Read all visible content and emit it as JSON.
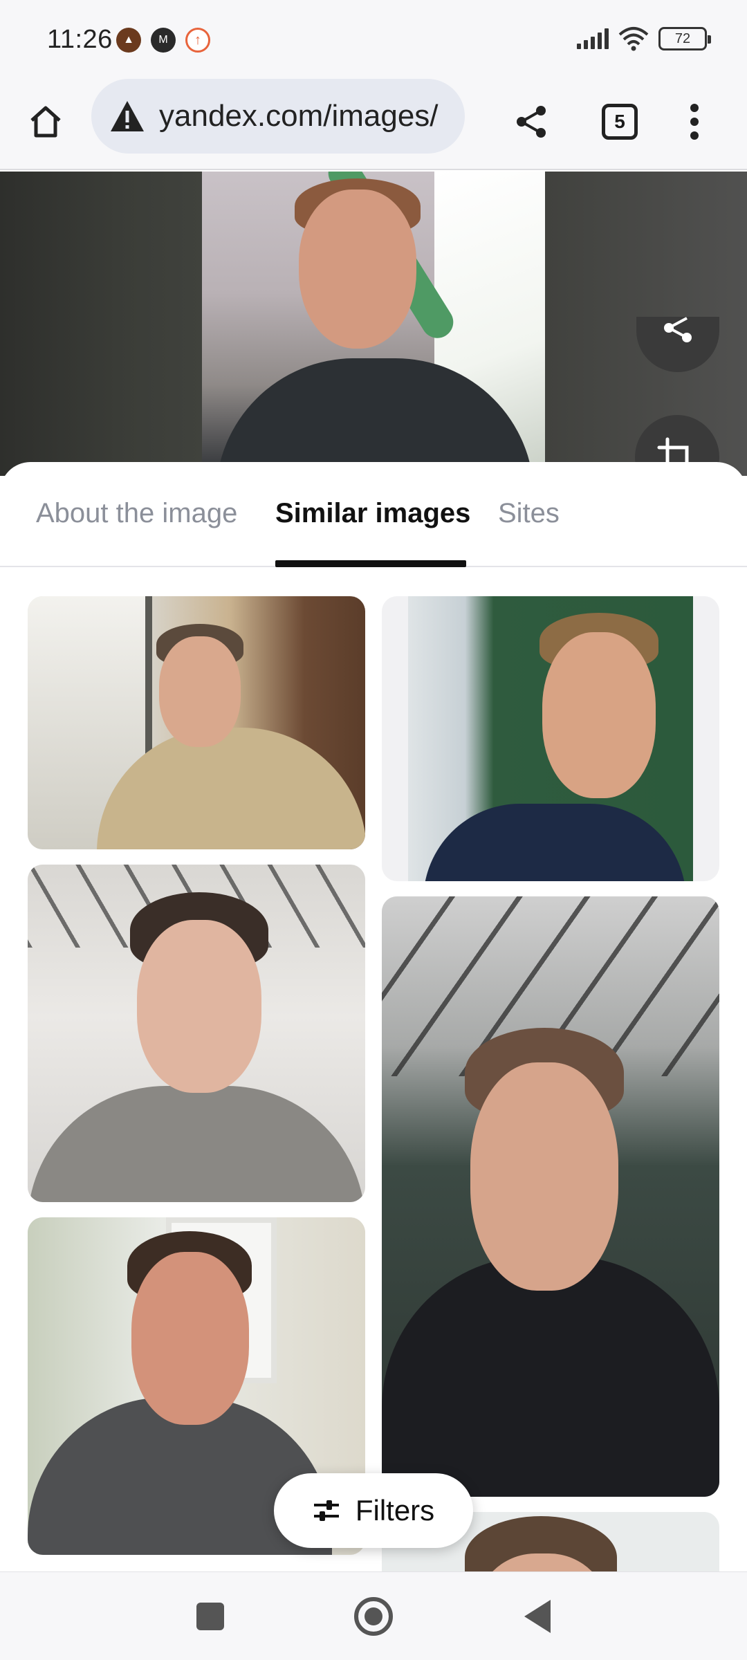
{
  "status_bar": {
    "time": "11:26",
    "battery": "72",
    "left_icons": [
      "shield-icon",
      "mi-icon",
      "upload-arrow-icon"
    ],
    "right_icons": [
      "signal-icon",
      "wifi-icon",
      "battery-icon"
    ]
  },
  "browser": {
    "url": "yandex.com/images/",
    "tab_count": "5",
    "icons": [
      "home-icon",
      "warning-icon",
      "share-icon",
      "tabs-icon",
      "more-vertical-icon"
    ]
  },
  "preview": {
    "actions": [
      "share-icon",
      "crop-icon"
    ]
  },
  "tabs": [
    {
      "label": "About the image",
      "active": false
    },
    {
      "label": "Similar images",
      "active": true
    },
    {
      "label": "Sites",
      "active": false
    }
  ],
  "results": {
    "tile_count": 7
  },
  "filters": {
    "label": "Filters",
    "icon": "sliders-icon"
  },
  "nav": {
    "icons": [
      "recents-square-icon",
      "home-circle-icon",
      "back-triangle-icon"
    ]
  },
  "colors": {
    "active_tab": "#111111",
    "inactive_tab": "#8b8f99",
    "url_pill": "#e6e9f1"
  }
}
